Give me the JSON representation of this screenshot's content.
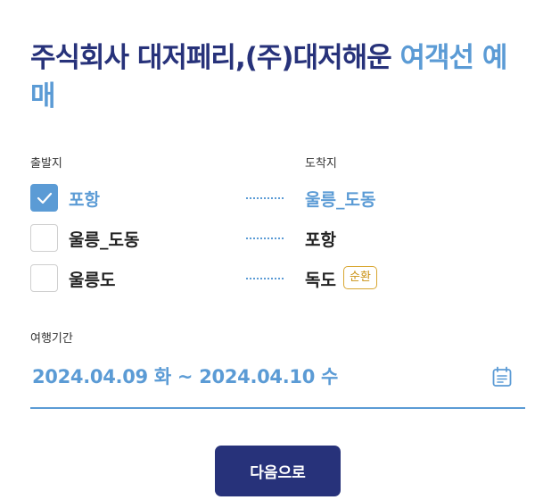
{
  "title": {
    "main": "주식회사 대저페리,(주)대저해운 ",
    "highlight": "여객선 예매"
  },
  "labels": {
    "departure": "출발지",
    "arrival": "도착지",
    "period": "여행기간"
  },
  "routes": [
    {
      "from": "포항",
      "to": "울릉_도동",
      "checked": true,
      "badge": ""
    },
    {
      "from": "울릉_도동",
      "to": "포항",
      "checked": false,
      "badge": ""
    },
    {
      "from": "울릉도",
      "to": "독도",
      "checked": false,
      "badge": "순환"
    }
  ],
  "date_range": "2024.04.09 화 ~ 2024.04.10 수",
  "next_button": "다음으로",
  "colors": {
    "navy": "#27327a",
    "accent": "#5b9bd5",
    "badge": "#d8a630"
  },
  "icons": {
    "checkbox_checked": "check-icon",
    "date": "calendar-icon"
  }
}
